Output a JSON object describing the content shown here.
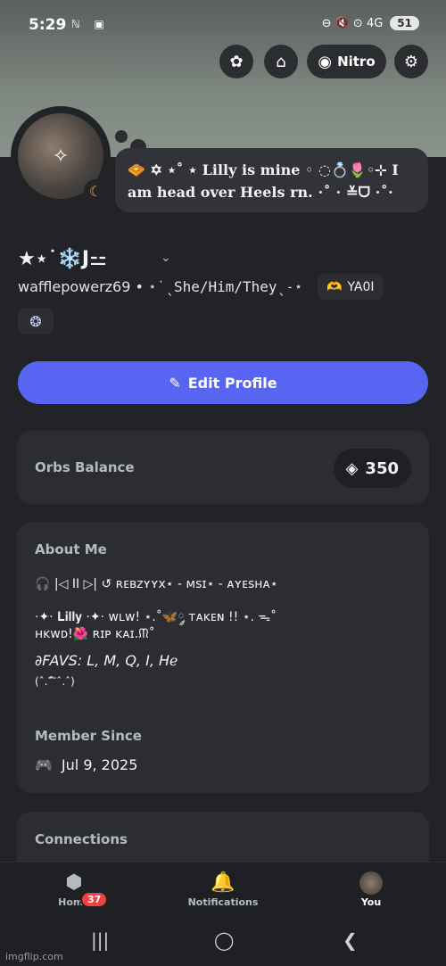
{
  "status_bar": {
    "time": "5:29",
    "left_icons": "ℕ ▣",
    "right_icons": "⊖ 🔇 ⊙ 4G",
    "battery": "51"
  },
  "header_buttons": {
    "nitro_label": "Nitro"
  },
  "bubble": {
    "text": "🧇 ✡ ⋆˚ ⋆ Lilly is mine ◦ ◌💍🌷◦⊹ I am head over Heels rn. ⋅˚ ⋅ ≚ᗜ ⋅˚⋅"
  },
  "profile": {
    "display_name": "★⋆˙❄️J⚍",
    "username": "wafflepowerz69",
    "separator": "•",
    "pronouns": "⋆˙ˎShe/Him/Theyˎ˗⋆",
    "tag_label": "YA0I",
    "tag_emoji": "🫶"
  },
  "edit_profile": {
    "label": "Edit Profile"
  },
  "orbs": {
    "label": "Orbs Balance",
    "value": "350"
  },
  "about": {
    "title": "About Me",
    "lines": [
      "🎧 |◁  II  ▷|  ↺ ʀᴇʙᴢʏʏx⋆ - ᴍsɪ⋆ - ᴀʏᴇsʜᴀ⋆",
      "⋅✦⋅ 𝐋𝐢𝐥𝐥𝐲 ⋅✦⋅ ᴡʟᴡ! ⋆.˚🦋༘ ᴛᴀᴋᴇɴ !! ⋆. ᯓ˚",
      "ʜᴋᴡᴅ!🌺  ʀɪᴘ ᴋᴀɪ.ᙏ˚",
      "∂FAVS: L, M, Q, I, Hℯ",
      "(ˆ.ˆ᷄ ᷅ˆ.ˆ)"
    ],
    "member_since_title": "Member Since",
    "member_since": "Jul 9, 2025"
  },
  "connections": {
    "title": "Connections"
  },
  "bottom_nav": {
    "home": "Home",
    "home_badge": "37",
    "notifications": "Notifications",
    "you": "You"
  },
  "watermark": "imgflip.com",
  "colors": {
    "accent": "#5865f2",
    "background": "#1e1f22",
    "card": "#2b2d31",
    "badge_red": "#f23f43"
  }
}
